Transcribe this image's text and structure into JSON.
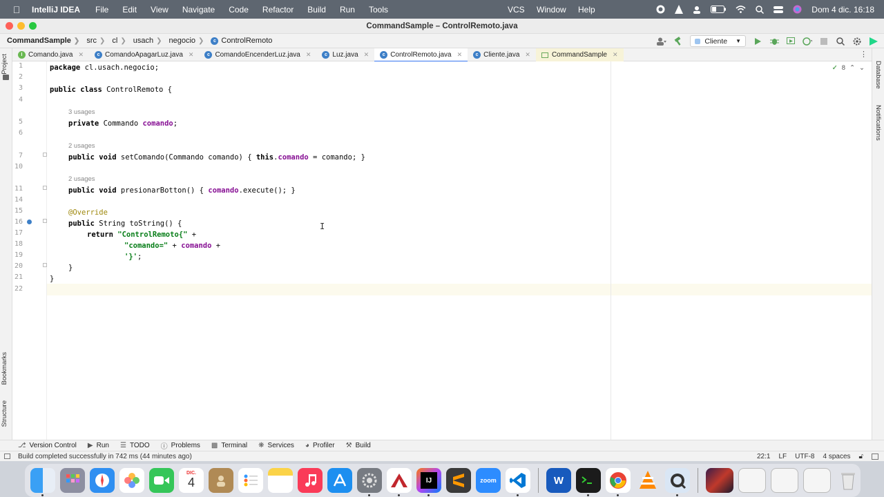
{
  "menubar": {
    "app_name": "IntelliJ IDEA",
    "items": [
      "File",
      "Edit",
      "View",
      "Navigate",
      "Code",
      "Refactor",
      "Build",
      "Run",
      "Tools"
    ],
    "right_items": [
      "VCS",
      "Window",
      "Help"
    ],
    "clock": "Dom 4 dic.  16:18"
  },
  "window": {
    "title": "CommandSample – ControlRemoto.java"
  },
  "breadcrumb": {
    "items": [
      "CommandSample",
      "src",
      "cl",
      "usach",
      "negocio",
      "ControlRemoto"
    ]
  },
  "run_config": {
    "label": "Cliente"
  },
  "tabs": [
    {
      "label": "Comando.java",
      "icon": "interface-icon"
    },
    {
      "label": "ComandoApagarLuz.java",
      "icon": "class-icon"
    },
    {
      "label": "ComandoEncenderLuz.java",
      "icon": "class-icon"
    },
    {
      "label": "Luz.java",
      "icon": "class-icon"
    },
    {
      "label": "ControlRemoto.java",
      "icon": "class-icon",
      "active": true
    },
    {
      "label": "Cliente.java",
      "icon": "class-icon"
    },
    {
      "label": "CommandSample",
      "icon": "project-icon"
    }
  ],
  "inspection": {
    "count": "8"
  },
  "code": {
    "line_numbers": [
      "1",
      "2",
      "3",
      "4",
      "5",
      "6",
      "7",
      "10",
      "11",
      "14",
      "15",
      "16",
      "17",
      "18",
      "19",
      "20",
      "21",
      "22"
    ],
    "usage_hints": [
      "3 usages",
      "2 usages",
      "2 usages"
    ],
    "l1_kw": "package",
    "l1_rest": " cl.usach.negocio;",
    "l3_kw": "public class",
    "l3_rest": " ControlRemoto {",
    "l5_kw": "private",
    "l5_type": " Commando ",
    "l5_field": "comando",
    "l5_end": ";",
    "l7_kw": "public void",
    "l7_a": " setComando(Commando comando) { ",
    "l7_this": "this",
    "l7_dot": ".",
    "l7_field": "comando",
    "l7_b": " = comando; }",
    "l11_kw": "public void",
    "l11_a": " presionarBotton() { ",
    "l11_field": "comando",
    "l11_b": ".execute(); }",
    "l15_ann": "@Override",
    "l16_kw": "public",
    "l16_rest": " String toString() {",
    "l17_kw": "return",
    "l17_str": " \"ControlRemoto{\"",
    "l17_rest": " +",
    "l18_str": "\"comando=\"",
    "l18_a": " + ",
    "l18_field": "comando",
    "l18_b": " +",
    "l19_str": "'}'",
    "l19_rest": ";",
    "l20": "}",
    "l21": "}"
  },
  "left_stripe": [
    "Project",
    "Bookmarks",
    "Structure"
  ],
  "right_stripe": [
    "Database",
    "Notifications"
  ],
  "bottom_tools": [
    "Version Control",
    "Run",
    "TODO",
    "Problems",
    "Terminal",
    "Services",
    "Profiler",
    "Build"
  ],
  "status": {
    "message": "Build completed successfully in 742 ms (44 minutes ago)",
    "position": "22:1",
    "line_sep": "LF",
    "encoding": "UTF-8",
    "indent": "4 spaces"
  },
  "dock": {
    "calendar_month": "DIC.",
    "calendar_day": "4",
    "zoom_label": "zoom",
    "intellij_label": "IJ"
  },
  "colors": {
    "accent": "#3574f0",
    "keyword": "#000000",
    "field": "#871094",
    "string": "#067d17",
    "annotation": "#9e880d"
  }
}
